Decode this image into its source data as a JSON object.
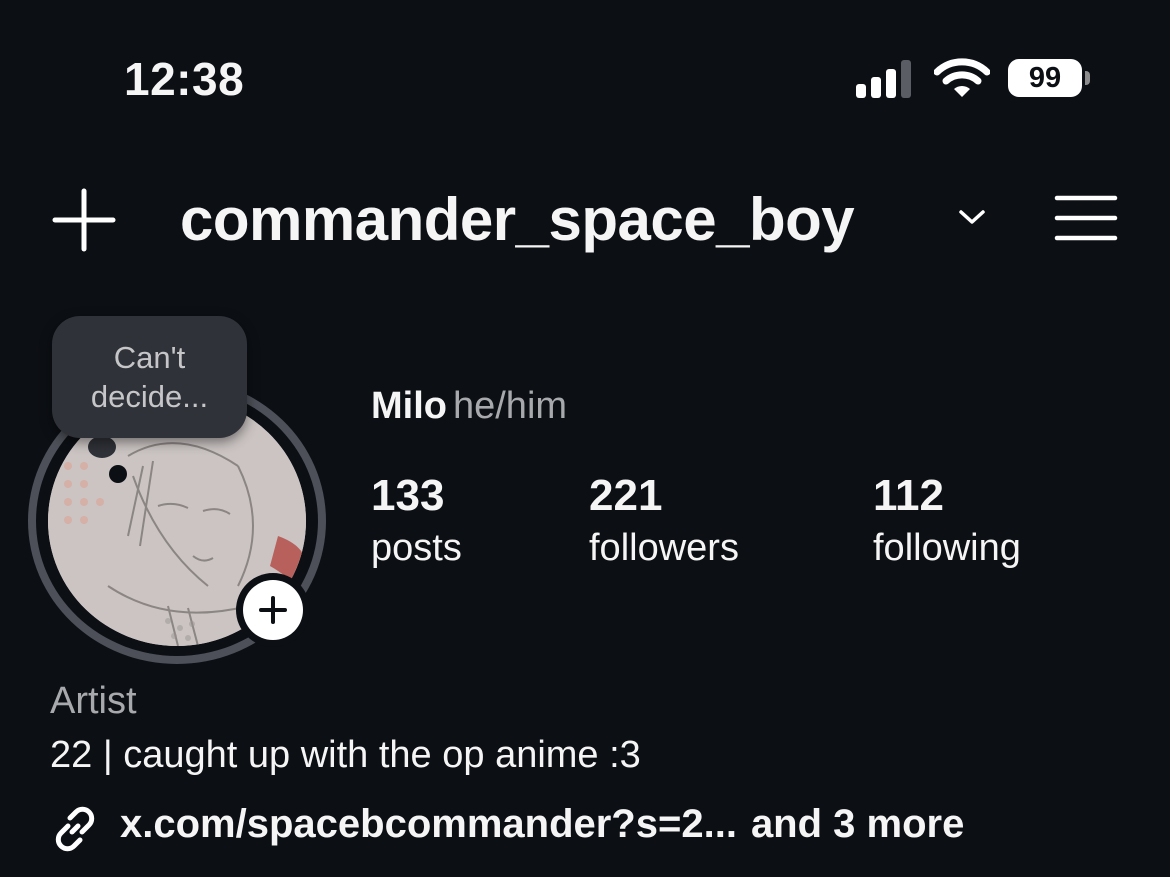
{
  "status_bar": {
    "time": "12:38",
    "battery": "99",
    "icons": [
      "cellular-signal-icon",
      "wifi-icon",
      "battery-icon"
    ]
  },
  "header": {
    "username": "commander_space_boy",
    "icons": [
      "plus-icon",
      "chevron-down-icon",
      "hamburger-menu-icon"
    ]
  },
  "note": {
    "text": "Can't decide..."
  },
  "profile": {
    "name": "Milo",
    "pronouns": "he/him",
    "stats": [
      {
        "value": "133",
        "label": "posts"
      },
      {
        "value": "221",
        "label": "followers"
      },
      {
        "value": "112",
        "label": "following"
      }
    ],
    "category": "Artist",
    "bio": "22 | caught up with the op anime :3",
    "link": "x.com/spacebcommander?s=2...",
    "link_more": "and 3 more"
  },
  "colors": {
    "background": "#0c0f14",
    "text": "#f5f5f5",
    "secondary_text": "#a8a9ad",
    "note_bubble": "#2f3238"
  }
}
